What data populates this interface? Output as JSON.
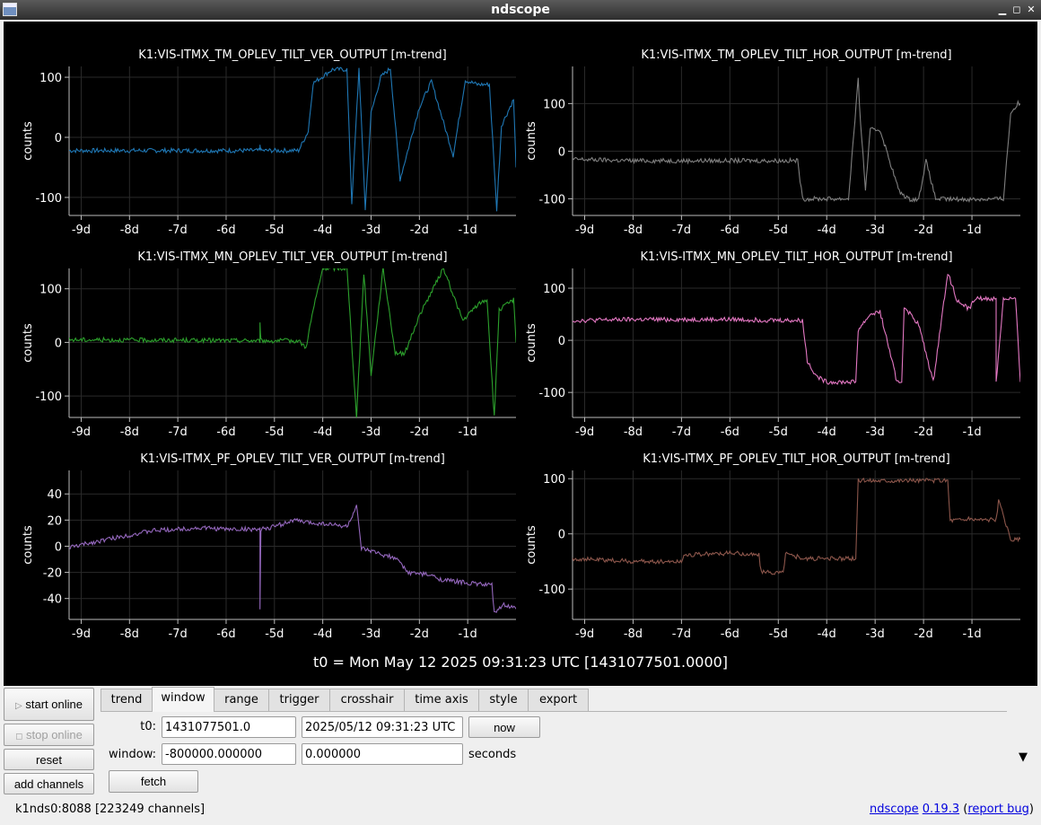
{
  "window": {
    "title": "ndscope",
    "minimize": "▁",
    "maximize": "◻",
    "close": "✕"
  },
  "plots": [
    {
      "title": "K1:VIS-ITMX_TM_OPLEV_TILT_VER_OUTPUT [m-trend]",
      "ylabel": "counts",
      "color": "#1f77b4",
      "yticks": [
        100,
        0,
        -100
      ],
      "ylim": [
        -130,
        118
      ],
      "points": [
        [
          -9.25,
          -22
        ],
        [
          -8,
          -22
        ],
        [
          -6,
          -22
        ],
        [
          -5.3,
          -22
        ],
        [
          -5.3,
          -12
        ],
        [
          -5.28,
          -22
        ],
        [
          -4.5,
          -22
        ],
        [
          -4.3,
          10
        ],
        [
          -4.2,
          90
        ],
        [
          -3.8,
          113
        ],
        [
          -3.5,
          113
        ],
        [
          -3.4,
          -110
        ],
        [
          -3.25,
          115
        ],
        [
          -3.12,
          -120
        ],
        [
          -3.0,
          40
        ],
        [
          -2.8,
          100
        ],
        [
          -2.6,
          115
        ],
        [
          -2.4,
          -70
        ],
        [
          -2.0,
          50
        ],
        [
          -1.75,
          93
        ],
        [
          -1.3,
          -30
        ],
        [
          -1.05,
          95
        ],
        [
          -0.8,
          88
        ],
        [
          -0.55,
          88
        ],
        [
          -0.4,
          -120
        ],
        [
          -0.3,
          20
        ],
        [
          -0.05,
          63
        ],
        [
          0,
          -50
        ]
      ]
    },
    {
      "title": "K1:VIS-ITMX_TM_OPLEV_TILT_HOR_OUTPUT [m-trend]",
      "ylabel": "counts",
      "color": "#7f7f7f",
      "yticks": [
        100,
        0,
        -100
      ],
      "ylim": [
        -135,
        178
      ],
      "points": [
        [
          -9.25,
          -17
        ],
        [
          -8,
          -20
        ],
        [
          -6,
          -20
        ],
        [
          -4.6,
          -20
        ],
        [
          -4.5,
          -100
        ],
        [
          -4.3,
          -100
        ],
        [
          -3.8,
          -100
        ],
        [
          -3.55,
          -100
        ],
        [
          -3.35,
          150
        ],
        [
          -3.3,
          60
        ],
        [
          -3.2,
          -80
        ],
        [
          -3.1,
          45
        ],
        [
          -2.9,
          45
        ],
        [
          -2.7,
          -20
        ],
        [
          -2.5,
          -85
        ],
        [
          -2.3,
          -101
        ],
        [
          -2.1,
          -101
        ],
        [
          -1.95,
          -20
        ],
        [
          -1.75,
          -100
        ],
        [
          -1.4,
          -101
        ],
        [
          -0.9,
          -101
        ],
        [
          -0.35,
          -100
        ],
        [
          -0.2,
          80
        ],
        [
          -0.05,
          100
        ],
        [
          0,
          100
        ]
      ]
    },
    {
      "title": "K1:VIS-ITMX_MN_OPLEV_TILT_VER_OUTPUT [m-trend]",
      "ylabel": "counts",
      "color": "#2ca02c",
      "yticks": [
        100,
        0,
        -100
      ],
      "ylim": [
        -140,
        138
      ],
      "points": [
        [
          -9.25,
          5
        ],
        [
          -7,
          4
        ],
        [
          -5.3,
          3
        ],
        [
          -5.3,
          40
        ],
        [
          -5.28,
          3
        ],
        [
          -4.5,
          3
        ],
        [
          -4.35,
          -10
        ],
        [
          -4.2,
          60
        ],
        [
          -4.0,
          138
        ],
        [
          -3.5,
          138
        ],
        [
          -3.3,
          -140
        ],
        [
          -3.15,
          130
        ],
        [
          -3.0,
          -60
        ],
        [
          -2.75,
          138
        ],
        [
          -2.5,
          -20
        ],
        [
          -2.3,
          -20
        ],
        [
          -2.0,
          50
        ],
        [
          -1.5,
          138
        ],
        [
          -1.1,
          40
        ],
        [
          -0.8,
          70
        ],
        [
          -0.6,
          80
        ],
        [
          -0.45,
          -140
        ],
        [
          -0.35,
          60
        ],
        [
          -0.05,
          80
        ],
        [
          0,
          0
        ]
      ]
    },
    {
      "title": "K1:VIS-ITMX_MN_OPLEV_TILT_HOR_OUTPUT [m-trend]",
      "ylabel": "counts",
      "color": "#e377c2",
      "yticks": [
        100,
        0,
        -100
      ],
      "ylim": [
        -148,
        138
      ],
      "points": [
        [
          -9.25,
          38
        ],
        [
          -8,
          40
        ],
        [
          -6,
          40
        ],
        [
          -4.5,
          38
        ],
        [
          -4.4,
          -40
        ],
        [
          -4.2,
          -70
        ],
        [
          -4.0,
          -80
        ],
        [
          -3.6,
          -80
        ],
        [
          -3.4,
          -80
        ],
        [
          -3.35,
          20
        ],
        [
          -3.1,
          50
        ],
        [
          -2.9,
          55
        ],
        [
          -2.7,
          -20
        ],
        [
          -2.55,
          -80
        ],
        [
          -2.45,
          -80
        ],
        [
          -2.4,
          65
        ],
        [
          -2.1,
          30
        ],
        [
          -1.8,
          -80
        ],
        [
          -1.5,
          130
        ],
        [
          -1.3,
          75
        ],
        [
          -1.05,
          60
        ],
        [
          -0.95,
          80
        ],
        [
          -0.6,
          80
        ],
        [
          -0.5,
          80
        ],
        [
          -0.5,
          -80
        ],
        [
          -0.35,
          80
        ],
        [
          -0.1,
          80
        ],
        [
          0,
          -80
        ]
      ]
    },
    {
      "title": "K1:VIS-ITMX_PF_OPLEV_TILT_VER_OUTPUT [m-trend]",
      "ylabel": "counts",
      "color": "#9467bd",
      "yticks": [
        40,
        20,
        0,
        -20,
        -40
      ],
      "ylim": [
        -56,
        58
      ],
      "points": [
        [
          -9.25,
          -1
        ],
        [
          -8.5,
          5
        ],
        [
          -7.5,
          12
        ],
        [
          -6.5,
          14
        ],
        [
          -6.0,
          13
        ],
        [
          -5.3,
          13
        ],
        [
          -5.3,
          -50
        ],
        [
          -5.28,
          13
        ],
        [
          -5.0,
          15
        ],
        [
          -4.6,
          20
        ],
        [
          -4.3,
          18
        ],
        [
          -3.9,
          17
        ],
        [
          -3.5,
          15
        ],
        [
          -3.3,
          30
        ],
        [
          -3.2,
          -2
        ],
        [
          -2.9,
          -5
        ],
        [
          -2.6,
          -8
        ],
        [
          -2.4,
          -12
        ],
        [
          -2.25,
          -20
        ],
        [
          -1.8,
          -22
        ],
        [
          -1.5,
          -26
        ],
        [
          -1.0,
          -28
        ],
        [
          -0.5,
          -30
        ],
        [
          -0.45,
          -50
        ],
        [
          -0.25,
          -45
        ],
        [
          0,
          -48
        ]
      ]
    },
    {
      "title": "K1:VIS-ITMX_PF_OPLEV_TILT_HOR_OUTPUT [m-trend]",
      "ylabel": "counts",
      "color": "#8c564b",
      "yticks": [
        100,
        0,
        -100
      ],
      "ylim": [
        -155,
        115
      ],
      "points": [
        [
          -9.25,
          -45
        ],
        [
          -8,
          -50
        ],
        [
          -7,
          -50
        ],
        [
          -6.95,
          -38
        ],
        [
          -6,
          -35
        ],
        [
          -5.4,
          -38
        ],
        [
          -5.35,
          -70
        ],
        [
          -4.9,
          -70
        ],
        [
          -4.85,
          -35
        ],
        [
          -4.7,
          -40
        ],
        [
          -4.4,
          -45
        ],
        [
          -3.4,
          -45
        ],
        [
          -3.35,
          97
        ],
        [
          -2.5,
          97
        ],
        [
          -1.5,
          97
        ],
        [
          -1.45,
          25
        ],
        [
          -1.0,
          27
        ],
        [
          -0.5,
          25
        ],
        [
          -0.45,
          60
        ],
        [
          -0.2,
          -10
        ],
        [
          0,
          -10
        ]
      ]
    }
  ],
  "xticks": [
    "-9d",
    "-8d",
    "-7d",
    "-6d",
    "-5d",
    "-4d",
    "-3d",
    "-2d",
    "-1d"
  ],
  "t0_text": "t0 = Mon May 12 2025 09:31:23 UTC [1431077501.0000]",
  "controls": {
    "start_online": "start online",
    "stop_online": "stop online",
    "reset": "reset",
    "add_channels": "add channels"
  },
  "tabs": [
    "trend",
    "window",
    "range",
    "trigger",
    "crosshair",
    "time axis",
    "style",
    "export"
  ],
  "active_tab": "window",
  "window_tab": {
    "t0_label": "t0:",
    "t0_gps": "1431077501.0",
    "t0_utc": "2025/05/12 09:31:23 UTC",
    "now_button": "now",
    "window_label": "window:",
    "window_start": "-800000.000000",
    "window_end": "0.000000",
    "seconds_label": "seconds",
    "fetch_button": "fetch"
  },
  "status": {
    "server": "k1nds0:8088",
    "channels": "[223249 channels]"
  },
  "links": {
    "app": "ndscope",
    "version": "0.19.3",
    "report": "report bug"
  }
}
